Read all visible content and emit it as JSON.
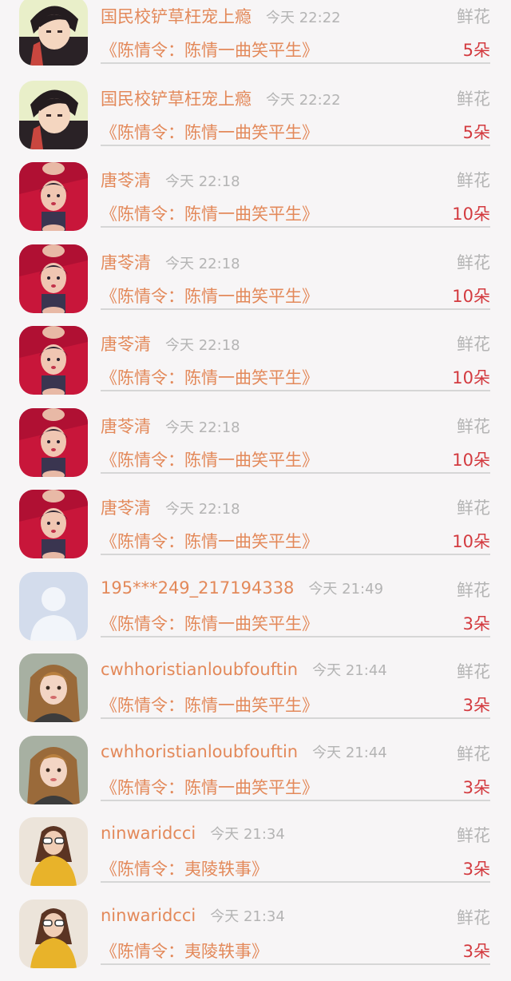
{
  "gift_list": {
    "items": [
      {
        "name": "国民校铲草枉宠上瘾",
        "time": "今天 22:22",
        "gift_type": "鲜花",
        "book": "《陈情令：陈情一曲笑平生》",
        "count": "5朵",
        "avatar_icon": "anime-boy-avatar"
      },
      {
        "name": "国民校铲草枉宠上瘾",
        "time": "今天 22:22",
        "gift_type": "鲜花",
        "book": "《陈情令：陈情一曲笑平生》",
        "count": "5朵",
        "avatar_icon": "anime-boy-avatar"
      },
      {
        "name": "唐苓清",
        "time": "今天 22:18",
        "gift_type": "鲜花",
        "book": "《陈情令：陈情一曲笑平生》",
        "count": "10朵",
        "avatar_icon": "boy-photo-avatar"
      },
      {
        "name": "唐苓清",
        "time": "今天 22:18",
        "gift_type": "鲜花",
        "book": "《陈情令：陈情一曲笑平生》",
        "count": "10朵",
        "avatar_icon": "boy-photo-avatar"
      },
      {
        "name": "唐苓清",
        "time": "今天 22:18",
        "gift_type": "鲜花",
        "book": "《陈情令：陈情一曲笑平生》",
        "count": "10朵",
        "avatar_icon": "boy-photo-avatar"
      },
      {
        "name": "唐苓清",
        "time": "今天 22:18",
        "gift_type": "鲜花",
        "book": "《陈情令：陈情一曲笑平生》",
        "count": "10朵",
        "avatar_icon": "boy-photo-avatar"
      },
      {
        "name": "唐苓清",
        "time": "今天 22:18",
        "gift_type": "鲜花",
        "book": "《陈情令：陈情一曲笑平生》",
        "count": "10朵",
        "avatar_icon": "boy-photo-avatar"
      },
      {
        "name": "195***249_217194338",
        "time": "今天 21:49",
        "gift_type": "鲜花",
        "book": "《陈情令：陈情一曲笑平生》",
        "count": "3朵",
        "avatar_icon": "default-user-avatar"
      },
      {
        "name": "cwhhoristianloubfouftin",
        "time": "今天 21:44",
        "gift_type": "鲜花",
        "book": "《陈情令：陈情一曲笑平生》",
        "count": "3朵",
        "avatar_icon": "girl-photo-avatar"
      },
      {
        "name": "cwhhoristianloubfouftin",
        "time": "今天 21:44",
        "gift_type": "鲜花",
        "book": "《陈情令：陈情一曲笑平生》",
        "count": "3朵",
        "avatar_icon": "girl-photo-avatar"
      },
      {
        "name": "ninwaridcci",
        "time": "今天 21:34",
        "gift_type": "鲜花",
        "book": "《陈情令：夷陵轶事》",
        "count": "3朵",
        "avatar_icon": "sunglasses-girl-avatar"
      },
      {
        "name": "ninwaridcci",
        "time": "今天 21:34",
        "gift_type": "鲜花",
        "book": "《陈情令：夷陵轶事》",
        "count": "3朵",
        "avatar_icon": "sunglasses-girl-avatar"
      }
    ]
  },
  "colors": {
    "name_orange": "#e3895a",
    "count_red": "#d33a3f",
    "gray_text": "#b4b4b4",
    "divider": "#d6d6d6",
    "background": "#f7f5f6"
  }
}
